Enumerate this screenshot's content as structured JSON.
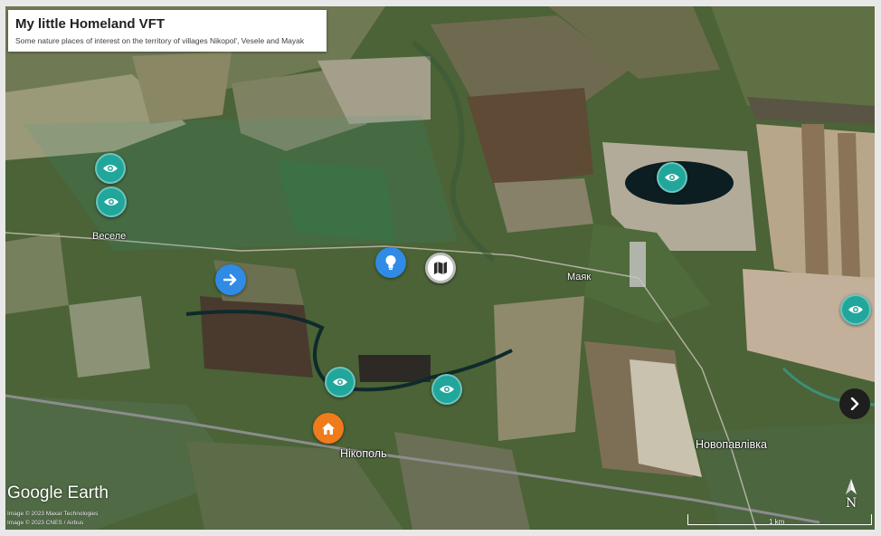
{
  "tour": {
    "title": "My little Homeland VFT",
    "subtitle": "Some nature places of interest on the territory of villages Nikopol', Vesele and Mayak"
  },
  "places": {
    "vesele": "Веселе",
    "mayak": "Маяк",
    "nikopol": "Нікополь",
    "novopavlivka": "Новопавлівка"
  },
  "markers": {
    "eye_icon": "eye-icon",
    "arrow_icon": "arrow-right-icon",
    "bulb_icon": "lightbulb-icon",
    "map_icon": "map-icon",
    "home_icon": "home-icon"
  },
  "branding": {
    "logo": "Google Earth",
    "imagery_line1": "Image © 2023 Maxar Technologies",
    "imagery_line2": "Image © 2023 CNES / Airbus"
  },
  "controls": {
    "compass_label": "N",
    "scale_label": "1 km"
  },
  "colors": {
    "teal_marker": "#21a69c",
    "blue_marker": "#2f8be6",
    "orange_marker": "#ef7b1a",
    "title_card": "#ffffff"
  }
}
